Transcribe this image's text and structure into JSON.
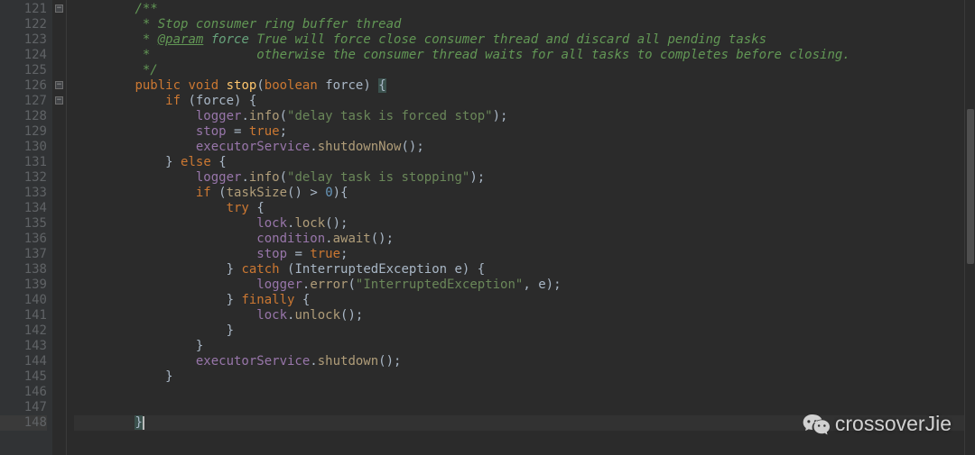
{
  "editor": {
    "first_line": 121,
    "last_line": 148,
    "caret_line": 148,
    "fold_markers": [
      {
        "line": 121,
        "glyph": "−"
      },
      {
        "line": 126,
        "glyph": "−"
      },
      {
        "line": 127,
        "glyph": "−"
      }
    ]
  },
  "code": {
    "lines": [
      {
        "n": 121,
        "indent": "        ",
        "tokens": [
          [
            "doc",
            "/**"
          ]
        ]
      },
      {
        "n": 122,
        "indent": "        ",
        "tokens": [
          [
            "doc",
            " * Stop consumer ring buffer thread"
          ]
        ]
      },
      {
        "n": 123,
        "indent": "        ",
        "tokens": [
          [
            "doc",
            " * "
          ],
          [
            "doctag",
            "@param"
          ],
          [
            "doc",
            " "
          ],
          [
            "docparam",
            "force"
          ],
          [
            "doc",
            " True will force close consumer thread and discard all pending tasks"
          ]
        ]
      },
      {
        "n": 124,
        "indent": "        ",
        "tokens": [
          [
            "doc",
            " *              otherwise the consumer thread waits for all tasks to completes before closing."
          ]
        ]
      },
      {
        "n": 125,
        "indent": "        ",
        "tokens": [
          [
            "doc",
            " */"
          ]
        ]
      },
      {
        "n": 126,
        "indent": "        ",
        "tokens": [
          [
            "kw",
            "public"
          ],
          [
            "op",
            " "
          ],
          [
            "kw",
            "void"
          ],
          [
            "op",
            " "
          ],
          [
            "mname",
            "stop"
          ],
          [
            "par",
            "("
          ],
          [
            "kw",
            "boolean"
          ],
          [
            "op",
            " "
          ],
          [
            "par",
            "force"
          ],
          [
            "par",
            ")"
          ],
          [
            "op",
            " "
          ],
          [
            "brace-match",
            "{"
          ]
        ]
      },
      {
        "n": 127,
        "indent": "            ",
        "tokens": [
          [
            "kw",
            "if"
          ],
          [
            "op",
            " "
          ],
          [
            "par",
            "("
          ],
          [
            "par",
            "force"
          ],
          [
            "par",
            ")"
          ],
          [
            "op",
            " "
          ],
          [
            "brace",
            "{"
          ]
        ]
      },
      {
        "n": 128,
        "indent": "                ",
        "tokens": [
          [
            "fld",
            "logger"
          ],
          [
            "op",
            "."
          ],
          [
            "mcall",
            "info"
          ],
          [
            "par",
            "("
          ],
          [
            "str",
            "\"delay task is forced stop\""
          ],
          [
            "par",
            ")"
          ],
          [
            "op",
            ";"
          ]
        ]
      },
      {
        "n": 129,
        "indent": "                ",
        "tokens": [
          [
            "fld",
            "stop"
          ],
          [
            "op",
            " = "
          ],
          [
            "kw",
            "true"
          ],
          [
            "op",
            ";"
          ]
        ]
      },
      {
        "n": 130,
        "indent": "                ",
        "tokens": [
          [
            "fld",
            "executorService"
          ],
          [
            "op",
            "."
          ],
          [
            "mcall",
            "shutdownNow"
          ],
          [
            "par",
            "()"
          ],
          [
            "op",
            ";"
          ]
        ]
      },
      {
        "n": 131,
        "indent": "            ",
        "tokens": [
          [
            "brace",
            "}"
          ],
          [
            "op",
            " "
          ],
          [
            "kw",
            "else"
          ],
          [
            "op",
            " "
          ],
          [
            "brace",
            "{"
          ]
        ]
      },
      {
        "n": 132,
        "indent": "                ",
        "tokens": [
          [
            "fld",
            "logger"
          ],
          [
            "op",
            "."
          ],
          [
            "mcall",
            "info"
          ],
          [
            "par",
            "("
          ],
          [
            "str",
            "\"delay task is stopping\""
          ],
          [
            "par",
            ")"
          ],
          [
            "op",
            ";"
          ]
        ]
      },
      {
        "n": 133,
        "indent": "                ",
        "tokens": [
          [
            "kw",
            "if"
          ],
          [
            "op",
            " "
          ],
          [
            "par",
            "("
          ],
          [
            "mcall",
            "taskSize"
          ],
          [
            "par",
            "()"
          ],
          [
            "op",
            " > "
          ],
          [
            "num",
            "0"
          ],
          [
            "par",
            ")"
          ],
          [
            "brace",
            "{"
          ]
        ]
      },
      {
        "n": 134,
        "indent": "                    ",
        "tokens": [
          [
            "kw",
            "try"
          ],
          [
            "op",
            " "
          ],
          [
            "brace",
            "{"
          ]
        ]
      },
      {
        "n": 135,
        "indent": "                        ",
        "tokens": [
          [
            "fld",
            "lock"
          ],
          [
            "op",
            "."
          ],
          [
            "mcall",
            "lock"
          ],
          [
            "par",
            "()"
          ],
          [
            "op",
            ";"
          ]
        ]
      },
      {
        "n": 136,
        "indent": "                        ",
        "tokens": [
          [
            "fld",
            "condition"
          ],
          [
            "op",
            "."
          ],
          [
            "mcall",
            "await"
          ],
          [
            "par",
            "()"
          ],
          [
            "op",
            ";"
          ]
        ]
      },
      {
        "n": 137,
        "indent": "                        ",
        "tokens": [
          [
            "fld",
            "stop"
          ],
          [
            "op",
            " = "
          ],
          [
            "kw",
            "true"
          ],
          [
            "op",
            ";"
          ]
        ]
      },
      {
        "n": 138,
        "indent": "                    ",
        "tokens": [
          [
            "brace",
            "}"
          ],
          [
            "op",
            " "
          ],
          [
            "kw",
            "catch"
          ],
          [
            "op",
            " "
          ],
          [
            "par",
            "("
          ],
          [
            "par",
            "InterruptedException e"
          ],
          [
            "par",
            ")"
          ],
          [
            "op",
            " "
          ],
          [
            "brace",
            "{"
          ]
        ]
      },
      {
        "n": 139,
        "indent": "                        ",
        "tokens": [
          [
            "fld",
            "logger"
          ],
          [
            "op",
            "."
          ],
          [
            "mcall",
            "error"
          ],
          [
            "par",
            "("
          ],
          [
            "str",
            "\"InterruptedException\""
          ],
          [
            "op",
            ", "
          ],
          [
            "par",
            "e"
          ],
          [
            "par",
            ")"
          ],
          [
            "op",
            ";"
          ]
        ]
      },
      {
        "n": 140,
        "indent": "                    ",
        "tokens": [
          [
            "brace",
            "}"
          ],
          [
            "op",
            " "
          ],
          [
            "kw",
            "finally"
          ],
          [
            "op",
            " "
          ],
          [
            "brace",
            "{"
          ]
        ]
      },
      {
        "n": 141,
        "indent": "                        ",
        "tokens": [
          [
            "fld",
            "lock"
          ],
          [
            "op",
            "."
          ],
          [
            "mcall",
            "unlock"
          ],
          [
            "par",
            "()"
          ],
          [
            "op",
            ";"
          ]
        ]
      },
      {
        "n": 142,
        "indent": "                    ",
        "tokens": [
          [
            "brace",
            "}"
          ]
        ]
      },
      {
        "n": 143,
        "indent": "                ",
        "tokens": [
          [
            "brace",
            "}"
          ]
        ]
      },
      {
        "n": 144,
        "indent": "                ",
        "tokens": [
          [
            "fld",
            "executorService"
          ],
          [
            "op",
            "."
          ],
          [
            "mcall",
            "shutdown"
          ],
          [
            "par",
            "()"
          ],
          [
            "op",
            ";"
          ]
        ]
      },
      {
        "n": 145,
        "indent": "            ",
        "tokens": [
          [
            "brace",
            "}"
          ]
        ]
      },
      {
        "n": 146,
        "indent": "",
        "tokens": []
      },
      {
        "n": 147,
        "indent": "",
        "tokens": []
      },
      {
        "n": 148,
        "indent": "        ",
        "tokens": [
          [
            "brace-match",
            "}"
          ]
        ],
        "caret": true
      }
    ]
  },
  "scrollbar": {
    "thumb_top_pct": 24,
    "thumb_height_pct": 34
  },
  "watermark": {
    "text": "crossoverJie"
  }
}
